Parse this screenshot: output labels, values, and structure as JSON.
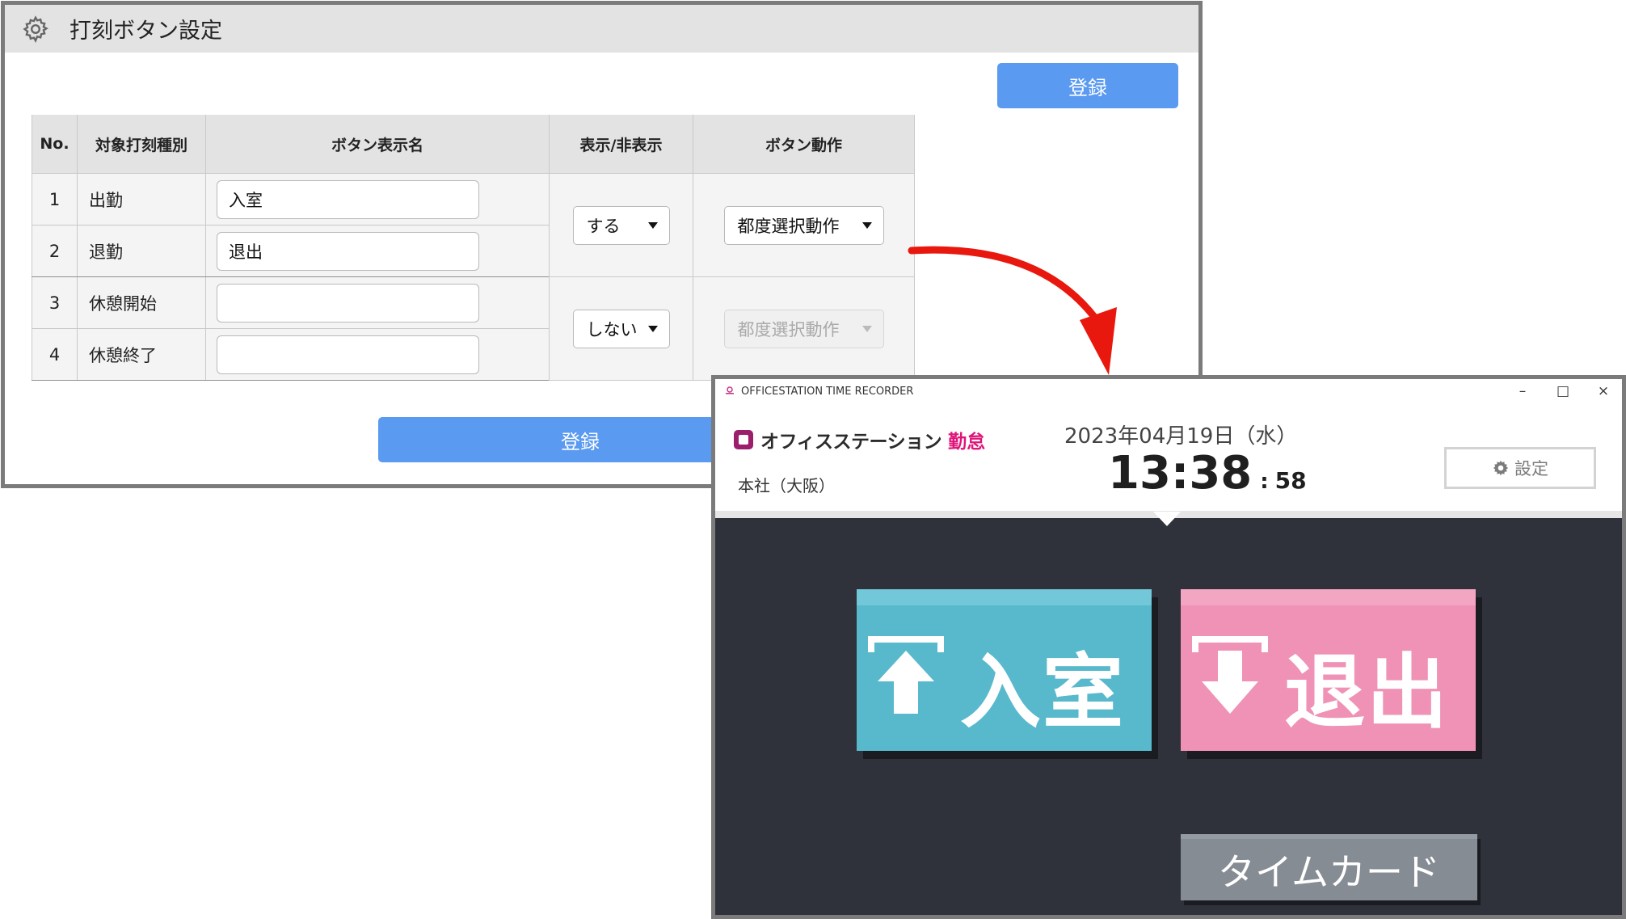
{
  "settings_panel": {
    "title": "打刻ボタン設定",
    "register_top_label": "登録",
    "register_bottom_label": "登録",
    "table": {
      "headers": [
        "No.",
        "対象打刻種別",
        "ボタン表示名",
        "表示/非表示",
        "ボタン動作"
      ],
      "rows": [
        {
          "no": "1",
          "type": "出勤",
          "name": "入室"
        },
        {
          "no": "2",
          "type": "退勤",
          "name": "退出"
        },
        {
          "no": "3",
          "type": "休憩開始",
          "name": ""
        },
        {
          "no": "4",
          "type": "休憩終了",
          "name": ""
        }
      ],
      "groups": [
        {
          "visibility": "する",
          "action": "都度選択動作",
          "action_disabled": false
        },
        {
          "visibility": "しない",
          "action": "都度選択動作",
          "action_disabled": true
        }
      ]
    }
  },
  "recorder": {
    "window_title": "OFFICESTATION TIME RECORDER",
    "window_controls": {
      "minimize": "–",
      "maximize": "□",
      "close": "×"
    },
    "brand": {
      "name": "オフィスステーション",
      "accent": "勤怠"
    },
    "location": "本社（大阪）",
    "date": "2023年04月19日（水）",
    "time": {
      "hm": "13:38",
      "sep": ":",
      "s": "58"
    },
    "settings_label": "設定",
    "buttons": {
      "in_label": "入室",
      "out_label": "退出",
      "timecard_label": "タイムカード"
    },
    "colors": {
      "in": "#58b9cd",
      "out": "#ef92b5",
      "body": "#2f323a",
      "accent": "#e0157a",
      "arrow": "#e8180f"
    }
  }
}
